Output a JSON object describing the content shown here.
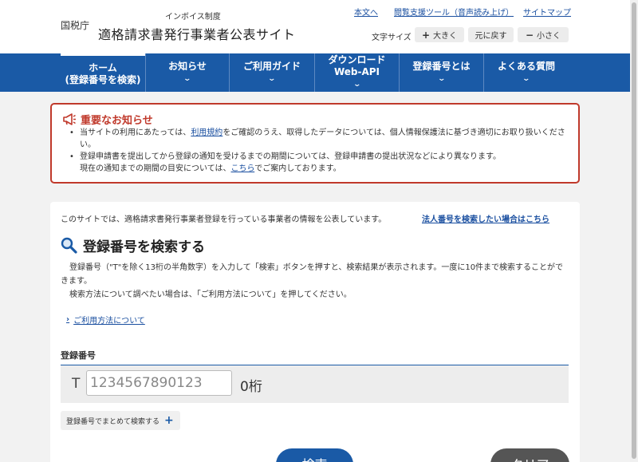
{
  "header": {
    "agency": "国税庁",
    "subtitle": "インボイス制度",
    "title": "適格請求書発行事業者公表サイト",
    "links": [
      "本文へ",
      "閲覧支援ツール（音声読み上げ）",
      "サイトマップ"
    ],
    "font_size_label": "文字サイズ",
    "font_buttons": {
      "larger": "大きく",
      "reset": "元に戻す",
      "smaller": "小さく"
    }
  },
  "nav": {
    "items": [
      {
        "line1": "ホーム",
        "line2": "(登録番号を検索)"
      },
      {
        "line1": "お知らせ",
        "line2": ""
      },
      {
        "line1": "ご利用ガイド",
        "line2": ""
      },
      {
        "line1": "ダウンロード",
        "line2": "Web-API"
      },
      {
        "line1": "登録番号とは",
        "line2": ""
      },
      {
        "line1": "よくある質問",
        "line2": ""
      }
    ]
  },
  "notice": {
    "title": "重要なお知らせ",
    "item1": {
      "before": "当サイトの利用にあたっては、",
      "link": "利用規約",
      "after": "をご確認のうえ、取得したデータについては、個人情報保護法に基づき適切にお取り扱いください。"
    },
    "item2": {
      "line1": "登録申請書を提出してから登録の通知を受けるまでの期間については、登録申請書の提出状況などにより異なります。",
      "before": "現在の通知までの期間の目安については、",
      "link": "こちら",
      "after": "でご案内しております。"
    }
  },
  "main": {
    "intro": "このサイトでは、適格請求書発行事業者登録を行っている事業者の情報を公表しています。",
    "corp_link": "法人番号を検索したい場合はこちら",
    "section_title": "登録番号を検索する",
    "desc1": "登録番号（\"T\"を除く13桁の半角数字）を入力して「検索」ボタンを押すと、検索結果が表示されます。一度に10件まで検索することができます。",
    "desc2": "検索方法について調べたい場合は、「ご利用方法について」を押してください。",
    "howto_link": "ご利用方法について",
    "field_label": "登録番号",
    "prefix": "T",
    "placeholder": "1234567890123",
    "value": "",
    "digit_count": "0桁",
    "bulk_button": "登録番号でまとめて検索する",
    "search_button": "検索",
    "clear_button": "クリア"
  },
  "colors": {
    "nav_bg": "#1a5aa6",
    "notice_border": "#c0392b",
    "link": "#1a4fa0",
    "clear_bg": "#555555"
  }
}
